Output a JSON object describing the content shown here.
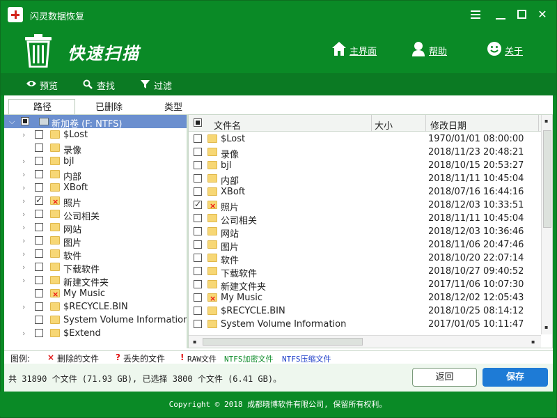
{
  "app": {
    "title": "闪灵数据恢复"
  },
  "header": {
    "title": "快速扫描",
    "home": "主界面",
    "help": "帮助",
    "about": "关于"
  },
  "toolbar": {
    "preview": "预览",
    "find": "查找",
    "filter": "过滤"
  },
  "tabs": {
    "path": "路径",
    "deleted": "已删除",
    "type": "类型"
  },
  "tree": {
    "root": "新加卷 (F: NTFS)",
    "items": [
      {
        "label": "$Lost",
        "checked": false,
        "deleted": false,
        "chevron": true
      },
      {
        "label": "录像",
        "checked": false,
        "deleted": false,
        "chevron": false
      },
      {
        "label": "bjl",
        "checked": false,
        "deleted": false,
        "chevron": true
      },
      {
        "label": "内部",
        "checked": false,
        "deleted": false,
        "chevron": true
      },
      {
        "label": "XBoft",
        "checked": false,
        "deleted": false,
        "chevron": true
      },
      {
        "label": "照片",
        "checked": true,
        "deleted": true,
        "chevron": true
      },
      {
        "label": "公司相关",
        "checked": false,
        "deleted": false,
        "chevron": true
      },
      {
        "label": "网站",
        "checked": false,
        "deleted": false,
        "chevron": true
      },
      {
        "label": "图片",
        "checked": false,
        "deleted": false,
        "chevron": true
      },
      {
        "label": "软件",
        "checked": false,
        "deleted": false,
        "chevron": true
      },
      {
        "label": "下载软件",
        "checked": false,
        "deleted": false,
        "chevron": true
      },
      {
        "label": "新建文件夹",
        "checked": false,
        "deleted": false,
        "chevron": true
      },
      {
        "label": "My Music",
        "checked": false,
        "deleted": true,
        "chevron": false
      },
      {
        "label": "$RECYCLE.BIN",
        "checked": false,
        "deleted": false,
        "chevron": true
      },
      {
        "label": "System Volume Information",
        "checked": false,
        "deleted": false,
        "chevron": false
      },
      {
        "label": "$Extend",
        "checked": false,
        "deleted": false,
        "chevron": true
      }
    ]
  },
  "list": {
    "columns": {
      "name": "文件名",
      "size": "大小",
      "date": "修改日期"
    },
    "rows": [
      {
        "name": "$Lost",
        "date": "1970/01/01 08:00:00",
        "checked": false,
        "deleted": false
      },
      {
        "name": "录像",
        "date": "2018/11/23 20:48:21",
        "checked": false,
        "deleted": false
      },
      {
        "name": "bjl",
        "date": "2018/10/15 20:53:27",
        "checked": false,
        "deleted": false
      },
      {
        "name": "内部",
        "date": "2018/11/11 10:45:04",
        "checked": false,
        "deleted": false
      },
      {
        "name": "XBoft",
        "date": "2018/07/16 16:44:16",
        "checked": false,
        "deleted": false
      },
      {
        "name": "照片",
        "date": "2018/12/03 10:33:51",
        "checked": true,
        "deleted": true
      },
      {
        "name": "公司相关",
        "date": "2018/11/11 10:45:04",
        "checked": false,
        "deleted": false
      },
      {
        "name": "网站",
        "date": "2018/12/03 10:36:46",
        "checked": false,
        "deleted": false
      },
      {
        "name": "图片",
        "date": "2018/11/06 20:47:46",
        "checked": false,
        "deleted": false
      },
      {
        "name": "软件",
        "date": "2018/10/20 22:07:14",
        "checked": false,
        "deleted": false
      },
      {
        "name": "下载软件",
        "date": "2018/10/27 09:40:52",
        "checked": false,
        "deleted": false
      },
      {
        "name": "新建文件夹",
        "date": "2017/11/06 10:07:30",
        "checked": false,
        "deleted": false
      },
      {
        "name": "My Music",
        "date": "2018/12/02 12:05:43",
        "checked": false,
        "deleted": true
      },
      {
        "name": "$RECYCLE.BIN",
        "date": "2018/10/25 08:14:12",
        "checked": false,
        "deleted": false
      },
      {
        "name": "System Volume Information",
        "date": "2017/01/05 10:11:47",
        "checked": false,
        "deleted": false
      }
    ]
  },
  "legend": {
    "label": "图例:",
    "deleted": "删除的文件",
    "lost": "丢失的文件",
    "raw": "RAW文件",
    "ntfs_encrypted": "NTFS加密文件",
    "ntfs_compressed": "NTFS压缩文件"
  },
  "status": {
    "text": "共 31890 个文件 (71.93 GB), 已选择 3800 个文件 (6.41 GB)。"
  },
  "buttons": {
    "back": "返回",
    "save": "保存"
  },
  "footer": {
    "copyright": "Copyright © 2018 成都晓博软件有限公司, 保留所有权利。"
  },
  "colors": {
    "brand_green": "#0a8a26",
    "save_blue": "#1e7bd6",
    "deleted_red": "#e11111",
    "ntfs_green": "#0a8a26",
    "ntfs_blue": "#1f3fc9"
  }
}
